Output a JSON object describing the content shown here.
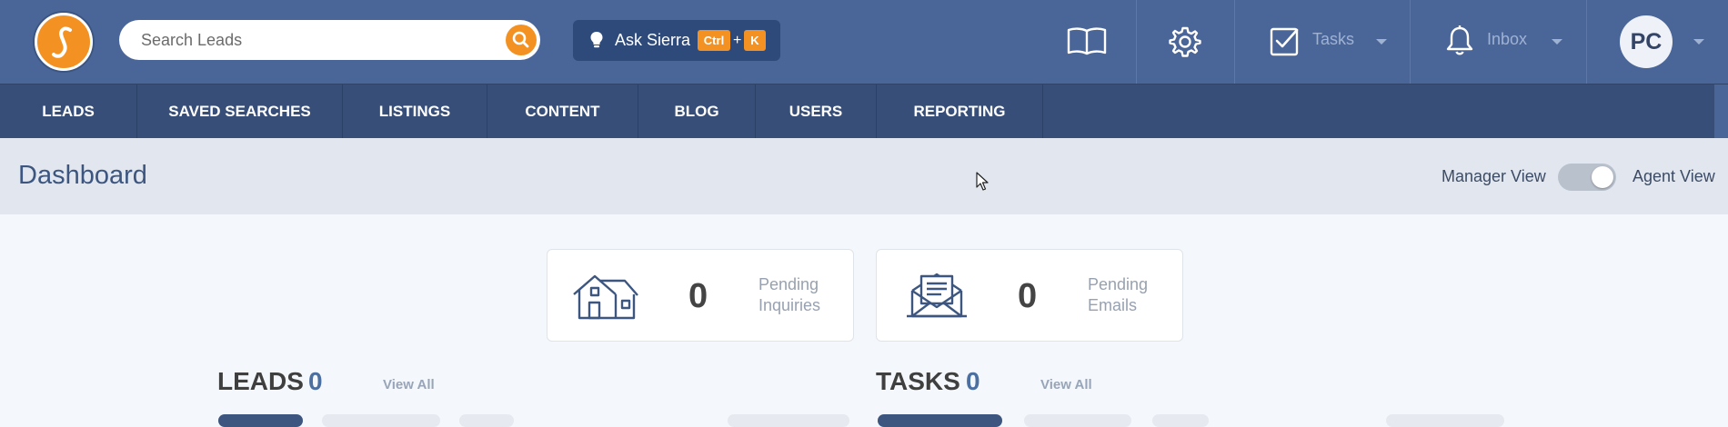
{
  "brand": {
    "logo_color": "#f39222",
    "primary_color": "#4a6598"
  },
  "search": {
    "placeholder": "Search Leads",
    "value": ""
  },
  "ask_sierra": {
    "label": "Ask Sierra",
    "key_ctrl": "Ctrl",
    "key_plus": "+",
    "key_k": "K"
  },
  "topbar": {
    "icons": [
      "book-icon",
      "gear-icon",
      "tasks-checkbox-icon",
      "bell-icon"
    ],
    "tasks_label": "Tasks",
    "inbox_label": "Inbox",
    "avatar_initials": "PC"
  },
  "nav": {
    "items": [
      "LEADS",
      "SAVED SEARCHES",
      "LISTINGS",
      "CONTENT",
      "BLOG",
      "USERS",
      "REPORTING"
    ]
  },
  "header": {
    "title": "Dashboard",
    "manager_view_label": "Manager View",
    "agent_view_label": "Agent View",
    "toggle_state": "agent"
  },
  "cards": [
    {
      "icon": "house-icon",
      "count": "0",
      "label_line1": "Pending",
      "label_line2": "Inquiries"
    },
    {
      "icon": "envelope-icon",
      "count": "0",
      "label_line1": "Pending",
      "label_line2": "Emails"
    }
  ],
  "sections": {
    "leads": {
      "title": "LEADS",
      "count": "0",
      "view_all": "View All"
    },
    "tasks": {
      "title": "TASKS",
      "count": "0",
      "view_all": "View All"
    }
  }
}
